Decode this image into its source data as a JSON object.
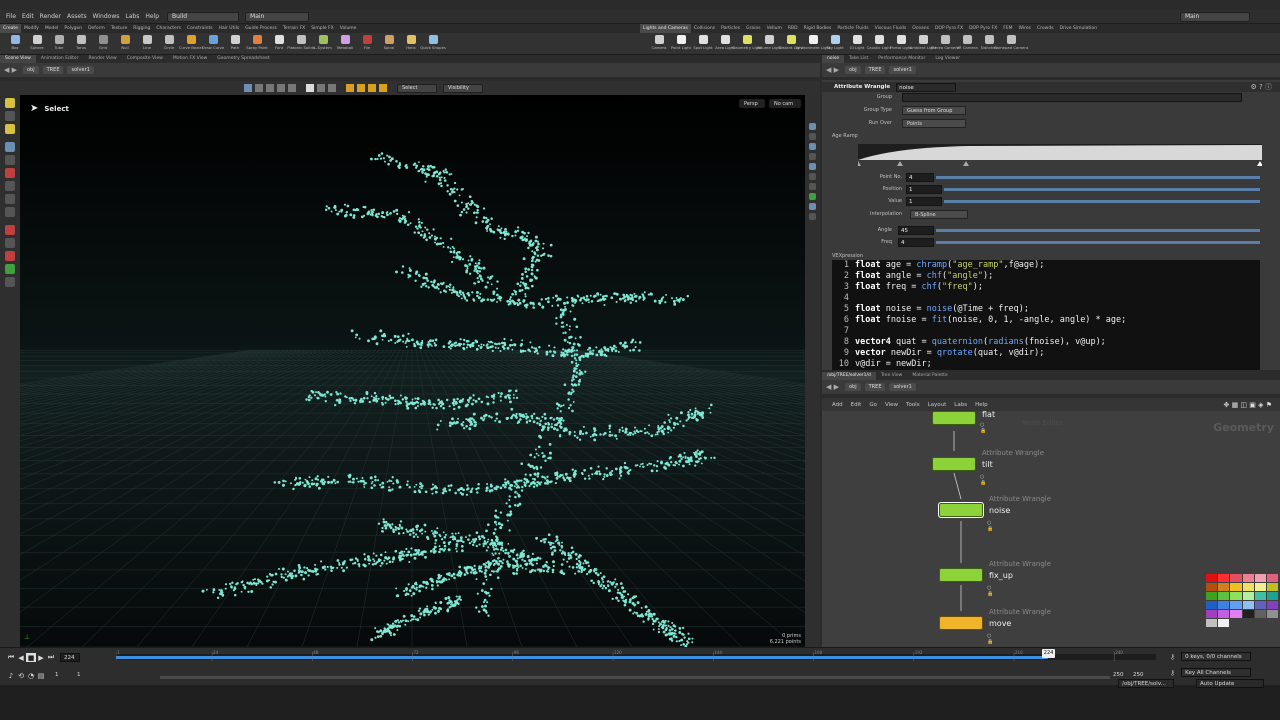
{
  "menubar": {
    "items": [
      "File",
      "Edit",
      "Render",
      "Assets",
      "Windows",
      "Labs",
      "Help"
    ],
    "desktop": "Build",
    "desktop2": "Main",
    "right_combo": "Main"
  },
  "shelf": {
    "tabs_left": [
      "Create",
      "Modify",
      "Model",
      "Polygon",
      "Deform",
      "Texture",
      "Rigging",
      "Characters",
      "Constraints",
      "Hair Utils",
      "Guide Process",
      "Terrain FX",
      "Simple FX",
      "Volume"
    ],
    "tabs_right": [
      "Lights and Cameras",
      "Collisions",
      "Particles",
      "Grains",
      "Vellum",
      "RBD",
      "Rigid Bodies",
      "Particle Fluids",
      "Viscous Fluids",
      "Oceans",
      "DOP Pyro FX",
      "DOP Pyro FX",
      "FEM",
      "Wires",
      "Crowds",
      "Drive Simulation"
    ],
    "tools_left": [
      "Box",
      "Sphere",
      "Tube",
      "Torus",
      "Grid",
      "Null",
      "Line",
      "Circle",
      "Curve Bezier",
      "Draw Curve",
      "Path",
      "Spray Paint",
      "Font",
      "Platonic Solids",
      "L-System",
      "Metaball",
      "File",
      "Spiral",
      "Helix",
      "Quick Shapes"
    ],
    "tools_right": [
      "Camera",
      "Point Light",
      "Spot Light",
      "Area Light",
      "Geometry Light",
      "Volume Light",
      "Distant Light",
      "Environment Light",
      "Sky Light",
      "GI Light",
      "Caustic Light",
      "Portal Light",
      "Ambient Light",
      "Stereo Camera",
      "VR Camera",
      "Switcher",
      "Gamepad Camera"
    ]
  },
  "scene_pane": {
    "tabs": [
      "Scene View",
      "Animation Editor",
      "Render View",
      "Composite View",
      "Motion FX View",
      "Geometry Spreadsheet"
    ],
    "path": [
      "obj",
      "TREE",
      "solver1"
    ],
    "toolbar_select": "Select",
    "toolbar_visibility": "Visibility",
    "tool_label": "Select",
    "persp": "Persp",
    "cam": "No cam",
    "prims": "0  prims",
    "points": "6,221  points"
  },
  "param_pane": {
    "tabs": [
      "Take List",
      "Performance Monitor",
      "Log Viewer"
    ],
    "first_tab": "noise",
    "path": [
      "obj",
      "TREE",
      "solver1"
    ],
    "node_type": "Attribute Wrangle",
    "node_name": "noise",
    "group_label": "Group",
    "group_type_label": "Group Type",
    "group_type_value": "Guess from Group",
    "run_over_label": "Run Over",
    "run_over_value": "Points",
    "ramp_label": "Age Ramp",
    "point_no_label": "Point No.",
    "point_no_value": "4",
    "position_label": "Position",
    "position_value": "1",
    "value_label": "Value",
    "value_value": "1",
    "interp_label": "Interpolation",
    "interp_value": "B-Spline",
    "angle_label": "Angle",
    "angle_value": "45",
    "freq_label": "Freq",
    "freq_value": "4",
    "vex_label": "VEXpression",
    "code": [
      {
        "n": "1",
        "t": "float age = chramp(\"age_ramp\",f@age);"
      },
      {
        "n": "2",
        "t": "float angle = chf(\"angle\");"
      },
      {
        "n": "3",
        "t": "float freq = chf(\"freq\");"
      },
      {
        "n": "4",
        "t": ""
      },
      {
        "n": "5",
        "t": "float noise = noise(@Time + freq);"
      },
      {
        "n": "6",
        "t": "float fnoise = fit(noise, 0, 1, -angle, angle) * age;"
      },
      {
        "n": "7",
        "t": ""
      },
      {
        "n": "8",
        "t": "vector4 quat = quaternion(radians(fnoise), v@up);"
      },
      {
        "n": "9",
        "t": "vector newDir = qrotate(quat, v@dir);"
      },
      {
        "n": "10",
        "t": "v@dir = newDir;"
      }
    ]
  },
  "network_pane": {
    "tabs": [
      "/obj/TREE/solver1/d",
      "Tree View",
      "Material Palette"
    ],
    "path": [
      "obj",
      "TREE",
      "solver1"
    ],
    "menu": [
      "Add",
      "Edit",
      "Go",
      "View",
      "Tools",
      "Layout",
      "Labs",
      "Help"
    ],
    "watermark": "Geometry",
    "faint_label": "Node Editor",
    "nodes": [
      {
        "type": "",
        "name": "flat",
        "color": "#8ed23a"
      },
      {
        "type": "Attribute Wrangle",
        "name": "tilt",
        "color": "#8ed23a"
      },
      {
        "type": "Attribute Wrangle",
        "name": "noise",
        "color": "#8ed23a"
      },
      {
        "type": "Attribute Wrangle",
        "name": "fix_up",
        "color": "#8ed23a"
      },
      {
        "type": "Attribute Wrangle",
        "name": "move",
        "color": "#f0b42a"
      }
    ]
  },
  "palette_colors": [
    "#e01010",
    "#ff3030",
    "#e05060",
    "#f08090",
    "#f0a0b0",
    "#e06080",
    "#b05010",
    "#d08020",
    "#f0c020",
    "#f0e060",
    "#f0f090",
    "#c0c020",
    "#40a020",
    "#60c040",
    "#90e060",
    "#b0f0a0",
    "#40c0a0",
    "#20a090",
    "#2060c0",
    "#4080e0",
    "#60a0f0",
    "#90c0f0",
    "#6060c0",
    "#8040c0",
    "#a040c0",
    "#c060e0",
    "#e080f0",
    "#202020",
    "#606060",
    "#909090",
    "#c0c0c0",
    "#f0f0f0"
  ],
  "timeline": {
    "frame": "224",
    "start": "1",
    "start2": "1",
    "end": "250",
    "end2": "250",
    "ticks": [
      "1",
      "24",
      "48",
      "72",
      "96",
      "120",
      "144",
      "168",
      "192",
      "216",
      "240"
    ],
    "current_marker": "224",
    "keys_info": "0 keys, 0/0 channels",
    "key_all": "Key All Channels",
    "path_status": "/obj/TREE/solv...",
    "auto_update": "Auto Update",
    "progress": 0.896
  }
}
